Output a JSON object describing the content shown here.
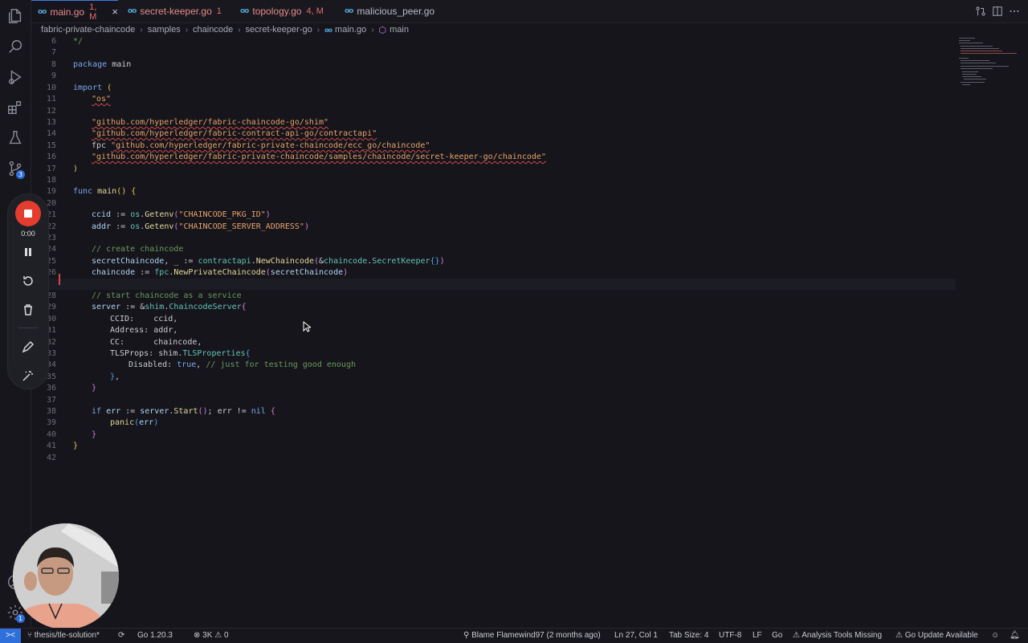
{
  "tabs": [
    {
      "name": "main.go",
      "flag": "1, M",
      "active": true,
      "flag_color": "#e26d6d"
    },
    {
      "name": "secret-keeper.go",
      "flag": "1",
      "active": false,
      "flag_color": "#e26d6d"
    },
    {
      "name": "topology.go",
      "flag": "4, M",
      "active": false,
      "flag_color": "#e26d6d"
    },
    {
      "name": "malicious_peer.go",
      "flag": "",
      "active": false
    }
  ],
  "tab_close": "×",
  "file_icon": "oo",
  "breadcrumb": [
    "fabric-private-chaincode",
    "samples",
    "chaincode",
    "secret-keeper-go",
    "main.go",
    "main"
  ],
  "activity": {
    "source_control_badge": "3",
    "settings_badge": "1"
  },
  "code": {
    "line_numbers": [
      "6",
      "7",
      "8",
      "9",
      "10",
      "11",
      "12",
      "13",
      "14",
      "15",
      "16",
      "17",
      "18",
      "19",
      "20",
      "21",
      "22",
      "23",
      "24",
      "25",
      "26",
      "27",
      "28",
      "29",
      "30",
      "31",
      "32",
      "33",
      "34",
      "35",
      "36",
      "37",
      "38",
      "39",
      "40",
      "41",
      "42"
    ],
    "current_line": "27",
    "t": {
      "l6": "*/",
      "l8a": "package",
      "l8b": "main",
      "l10a": "import",
      "l10b": "(",
      "l11": "\"os\"",
      "l13": "\"github.com/hyperledger/fabric-chaincode-go/shim\"",
      "l14": "\"github.com/hyperledger/fabric-contract-api-go/contractapi\"",
      "l15a": "fpc",
      "l15b": "\"github.com/hyperledger/fabric-private-chaincode/ecc_go/chaincode\"",
      "l16": "\"github.com/hyperledger/fabric-private-chaincode/samples/chaincode/secret-keeper-go/chaincode\"",
      "l17": ")",
      "l19a": "func",
      "l19b": "main",
      "l19c": "()",
      "l19d": "{",
      "l21a": "ccid",
      "l21b": " := ",
      "l21c": "os",
      "l21d": ".",
      "l21e": "Getenv",
      "l21f": "(",
      "l21g": "\"CHAINCODE_PKG_ID\"",
      "l21h": ")",
      "l22a": "addr",
      "l22b": " := ",
      "l22c": "os",
      "l22d": ".",
      "l22e": "Getenv",
      "l22f": "(",
      "l22g": "\"CHAINCODE_SERVER_ADDRESS\"",
      "l22h": ")",
      "l24": "// create chaincode",
      "l25a": "secretChaincode",
      "l25b": ", _ := ",
      "l25c": "contractapi",
      "l25d": ".",
      "l25e": "NewChaincode",
      "l25f": "(",
      "l25g": "&",
      "l25h": "chaincode",
      "l25i": ".",
      "l25j": "SecretKeeper",
      "l25k": "{}",
      "l25l": ")",
      "l26a": "chaincode",
      "l26b": " := ",
      "l26c": "fpc",
      "l26d": ".",
      "l26e": "NewPrivateChaincode",
      "l26f": "(",
      "l26g": "secretChaincode",
      "l26h": ")",
      "l28": "// start chaincode as a service",
      "l29a": "server",
      "l29b": " := &",
      "l29c": "shim",
      "l29d": ".",
      "l29e": "ChaincodeServer",
      "l29f": "{",
      "l30a": "CCID:",
      "l30b": "    ccid,",
      "l31a": "Address:",
      "l31b": " addr,",
      "l32a": "CC:",
      "l32b": "      chaincode,",
      "l33a": "TLSProps:",
      "l33b": " shim",
      "l33c": ".",
      "l33d": "TLSProperties",
      "l33e": "{",
      "l34a": "Disabled:",
      "l34b": " true",
      "l34c": ", ",
      "l34d": "// just for testing good enough",
      "l35a": "}",
      "l35b": ",",
      "l36": "}",
      "l38a": "if",
      "l38b": " err",
      "l38c": " := ",
      "l38d": "server",
      "l38e": ".",
      "l38f": "Start",
      "l38g": "()",
      "l38h": "; err != ",
      "l38i": "nil",
      "l38j": " {",
      "l39a": "panic",
      "l39b": "(",
      "l39c": "err",
      "l39d": ")",
      "l40": "}",
      "l41": "}"
    }
  },
  "recorder": {
    "time": "0:00"
  },
  "status": {
    "remote": "><",
    "branch": "thesis/tle-solution*",
    "go_version": "Go 1.20.3",
    "problems": "3K",
    "warnings": "0",
    "blame": "Blame Flamewind97 (2 months ago)",
    "position": "Ln 27, Col 1",
    "tab_size": "Tab Size: 4",
    "encoding": "UTF-8",
    "eol": "LF",
    "language": "Go",
    "analysis": "Analysis Tools Missing",
    "go_update": "Go Update Available"
  },
  "colors": {
    "accent": "#2f6fdc",
    "record": "#e43d30",
    "error": "#d04a4a"
  }
}
